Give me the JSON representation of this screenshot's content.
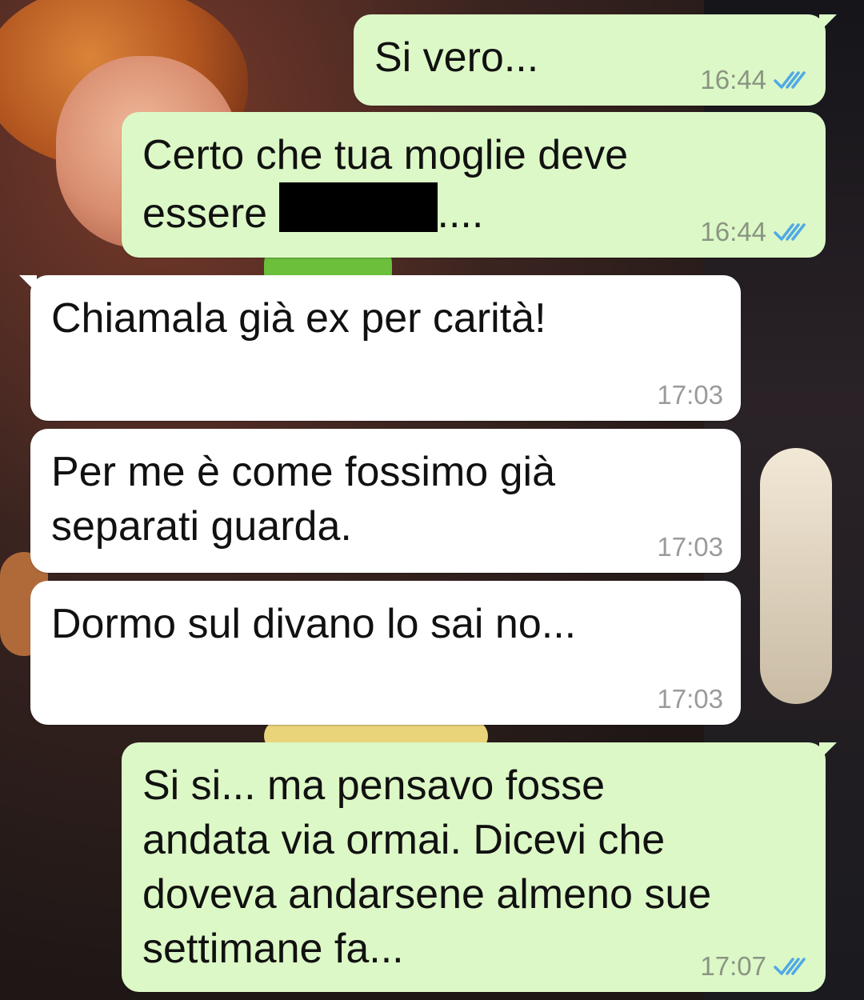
{
  "messages": [
    {
      "direction": "out",
      "text": "Si vero...",
      "time": "16:44",
      "status": "read"
    },
    {
      "direction": "out",
      "line1": "Certo che tua moglie deve",
      "line2_before": "essere",
      "line2_after": "....",
      "time": "16:44",
      "status": "read",
      "redacted": true
    },
    {
      "direction": "in",
      "text": "Chiamala già ex per carità!",
      "time": "17:03"
    },
    {
      "direction": "in",
      "line1": "Per me è come fossimo già",
      "line2": "separati guarda.",
      "time": "17:03"
    },
    {
      "direction": "in",
      "text": "Dormo sul divano lo sai no...",
      "time": "17:03"
    },
    {
      "direction": "out",
      "lines": [
        "Si si... ma pensavo fosse",
        "andata via ormai. Dicevi che",
        "doveva andarsene almeno sue",
        "settimane fa..."
      ],
      "time": "17:07",
      "status": "read"
    }
  ],
  "colors": {
    "outgoing_bubble": "#dcf8c6",
    "incoming_bubble": "#ffffff",
    "read_ticks": "#4fa9e6"
  },
  "icons": {
    "read_receipt": "double-check-icon"
  }
}
